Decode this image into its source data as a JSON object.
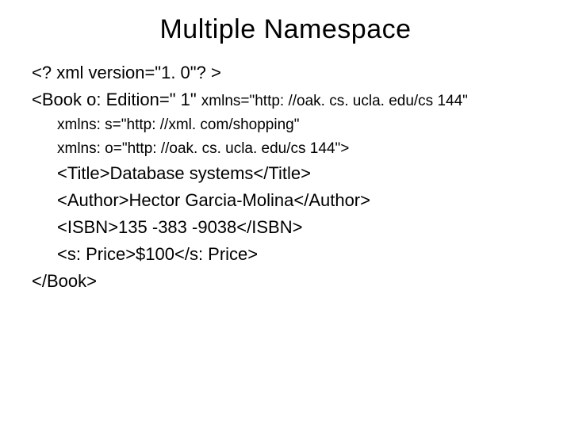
{
  "title": "Multiple Namespace",
  "lines": {
    "l1": "<? xml version=\"1. 0\"? >",
    "l2a": "<Book ",
    "l2b": "o: ",
    "l2c": "Edition=\" 1\" ",
    "l2d": "xmlns=\"http: //oak. cs. ucla. edu/cs 144\"",
    "l3": "xmlns: s=\"http: //xml. com/shopping\"",
    "l4": "xmlns: o=\"http: //oak. cs. ucla. edu/cs 144\">",
    "l5": "<Title>Database systems</Title>",
    "l6": "<Author>Hector Garcia-Molina</Author>",
    "l7": "<ISBN>135 -383 -9038</ISBN>",
    "l8": "<s: Price>$100</s: Price>",
    "l9": "</Book>"
  }
}
